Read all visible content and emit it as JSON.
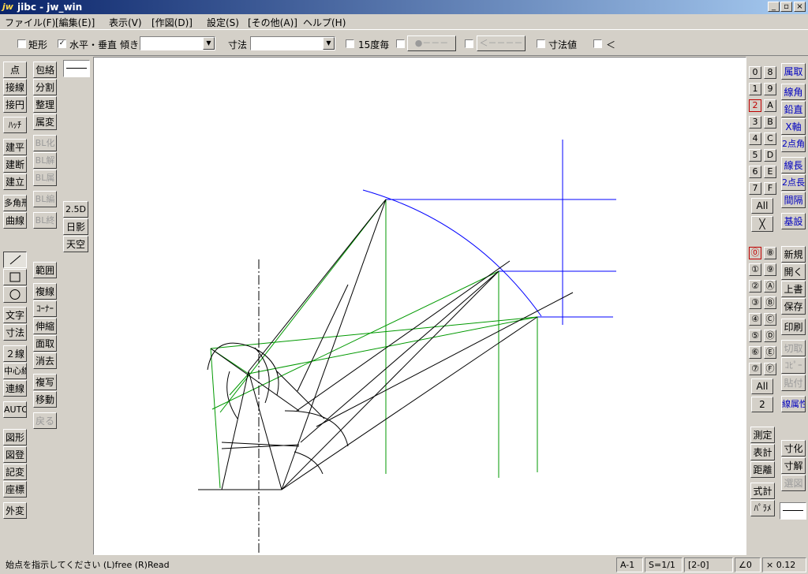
{
  "title": {
    "logo": "jw",
    "text": "jibc - jw_win"
  },
  "menu": [
    "ファイル(F)",
    "[編集(E)]",
    "表示(V)",
    "[作図(D)]",
    "設定(S)",
    "[その他(A)]",
    "ヘルプ(H)"
  ],
  "toolbar": {
    "rect": "矩形",
    "horiz": "水平・垂直",
    "tilt": "傾き",
    "dim": "寸法",
    "deg15": "15度毎",
    "btn1": "●－－－",
    "btn2": "＜－－－－",
    "dimval": "寸法値",
    "lt": "＜"
  },
  "left_col1": {
    "g1": [
      "点",
      "接線",
      "接円",
      "ﾊｯﾁ"
    ],
    "g2": [
      "建平",
      "建断",
      "建立"
    ],
    "g3": [
      "多角形",
      "曲線"
    ],
    "g4": [
      "文字",
      "寸法"
    ],
    "g5": [
      "２線",
      "中心線",
      "連線",
      "AUTO"
    ],
    "g6": [
      "図形",
      "図登",
      "記変",
      "座標",
      "外変"
    ]
  },
  "left_col2": {
    "g1": [
      "包絡",
      "分割",
      "整理",
      "属変"
    ],
    "g2": [
      "BL化",
      "BL解",
      "BL属"
    ],
    "g3": [
      "BL編",
      "BL終"
    ],
    "g4": [
      "範囲",
      "複線",
      "ｺｰﾅｰ",
      "伸縮",
      "面取",
      "消去",
      "複写",
      "移動",
      "戻る"
    ],
    "g_mid": [
      "2.5D",
      "日影",
      "天空"
    ]
  },
  "right_layers": {
    "groups_top": [
      [
        "0",
        "8"
      ],
      [
        "1",
        "9"
      ],
      [
        "2",
        "A"
      ],
      [
        "3",
        "B"
      ],
      [
        "4",
        "C"
      ],
      [
        "5",
        "D"
      ],
      [
        "6",
        "E"
      ],
      [
        "7",
        "F"
      ]
    ],
    "all": "All",
    "x": "╳",
    "groups_bottom": [
      [
        "⓪",
        "⑧"
      ],
      [
        "①",
        "⑨"
      ],
      [
        "②",
        "Ⓐ"
      ],
      [
        "③",
        "Ⓑ"
      ],
      [
        "④",
        "Ⓒ"
      ],
      [
        "⑤",
        "Ⓓ"
      ],
      [
        "⑥",
        "Ⓔ"
      ],
      [
        "⑦",
        "Ⓕ"
      ]
    ],
    "all2": "All",
    "num": "2"
  },
  "right_col": {
    "g1": [
      "属取",
      "線角",
      "鉛直",
      "X軸",
      "2点角"
    ],
    "g2": [
      "線長",
      "2点長",
      "間隔"
    ],
    "g3": [
      "基設"
    ],
    "g4": [
      "新規",
      "開く",
      "上書",
      "保存",
      "印刷"
    ],
    "g5": [
      "切取",
      "ｺﾋﾟｰ",
      "貼付"
    ],
    "g6": [
      "線属性"
    ],
    "g7": [
      "測定",
      "表計",
      "距離",
      "式計",
      "ﾊﾟﾗﾒ"
    ],
    "g8": [
      "寸化",
      "寸解",
      "選図"
    ]
  },
  "status": {
    "msg": "始点を指示してください (L)free (R)Read",
    "paper": "A-1",
    "scale": "S=1/1",
    "layer": "[2-0]",
    "angle": "∠0",
    "zoom": "× 0.12"
  },
  "colors": {
    "blue": "#0000ff",
    "green": "#009900",
    "black": "#000000"
  }
}
